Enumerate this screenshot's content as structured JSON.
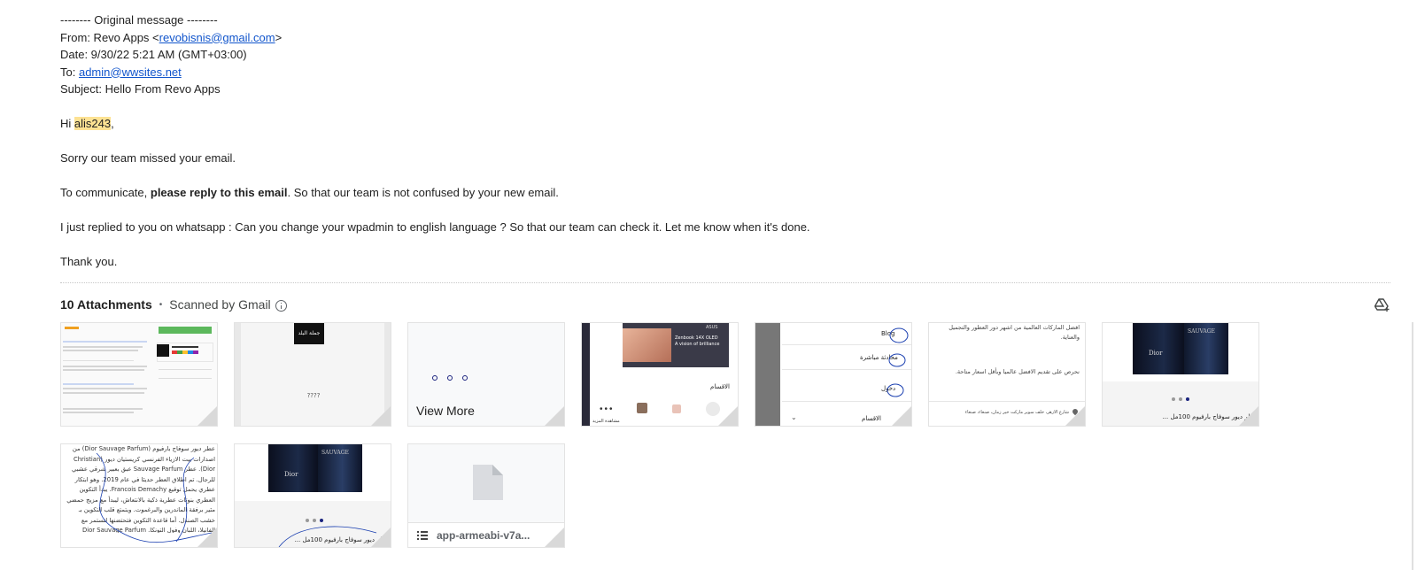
{
  "email": {
    "original_header": "-------- Original message --------",
    "from_label": "From: Revo Apps <",
    "from_email": "revobisnis@gmail.com",
    "from_close": ">",
    "date_line": "Date: 9/30/22 5:21 AM (GMT+03:00)",
    "to_label": "To: ",
    "to_email": "admin@wwsites.net",
    "subject_line": "Subject: Hello From Revo Apps",
    "greeting_prefix": "Hi ",
    "greeting_name": "alis243",
    "greeting_suffix": ",",
    "sorry_line": "Sorry our team missed your email.",
    "communicate_prefix": "To communicate, ",
    "communicate_bold": "please reply to this email",
    "communicate_suffix": ". So that our team is not confused by your new email.",
    "whatsapp_line": "I just replied to you on whatsapp : Can you change your wpadmin to english language ? So that our team can check it. Let me know when it's done.",
    "thanks_line": "Thank you."
  },
  "attachments": {
    "count_label": "10 Attachments",
    "separator": "•",
    "scanned_label": "Scanned by Gmail",
    "view_more": "View More",
    "file_name": "app-armeabi-v7a...",
    "tile2_text": "????",
    "tile2_logo": "جملة البلد",
    "tile4_brand": "ASUS",
    "tile4_banner_line1": "Zenbook 14X OLED",
    "tile4_banner_line2": "A vision of brilliance",
    "tile4_section": "الاقسام",
    "tile4_more": "مشاهدة المزيد",
    "tile5_item1": "Blog",
    "tile5_item2": "محادثة مباشرة",
    "tile5_item3": "دخول",
    "tile5_item4": "الاقسام",
    "tile6_text1": "افضل الماركات العالمية من اشهر دور العطور والتجميل والعناية.",
    "tile6_text2": "نحرص على تقديم الافضل عالميا وبأقل اسعار متاحة.",
    "tile6_address": "شارع الازهر، خلف سوبر ماركت خير زمان، صنعاء، صنعاء",
    "tile7_caption": "عطر ديور سوفاج بارفيوم 100مل ...",
    "tile8_text": "عطر ديور سوفاج بارفيوم (Dior Sauvage Parfum) من اصدارات بيت الازياء الفرنسي كريستيان ديور (Christian Dior). عطر Sauvage Parfum عبق بعبير شرقي عشبي للرجال. تم اطلاق العطر حديثا في عام 2019. وهو ابتكار عطري يحمل توقيع Francois Demachy. يبدأ التكوين العطري بنوتات عطرية ذكية بالانتعاش، ليبدأ مع مزيج حمضي مثير برفقة الماندرين والبرغموت. ويتمتع قلب التكوين بـ خشب الصندل. أما قاعدة التكوين فتحتضنها لتستمر مع الفانيلا، اللبان وفول التونكا. Dior Sauvage Parfum 100ml",
    "tile9_caption": "عطر ديور سوفاج بارفيوم 100مل ...",
    "dior_label": "Dior",
    "sauvage_label": "SAUVAGE"
  },
  "colors": {
    "link": "#1155cc",
    "highlight": "#fde293",
    "accent_dot": "#1a237e"
  },
  "icons": {
    "info": "info-icon",
    "add_to_drive": "add-to-drive-icon",
    "file": "file-icon",
    "list": "list-icon"
  }
}
